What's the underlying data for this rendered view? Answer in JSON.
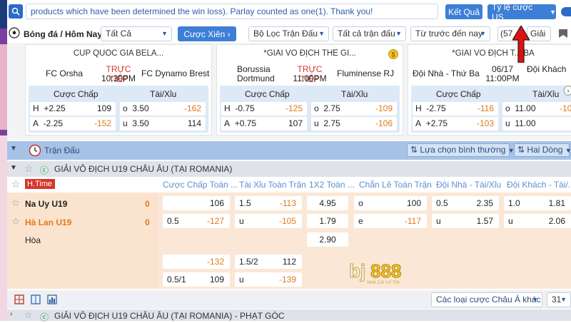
{
  "topbar": {
    "ticker": "products which have been determined the win loss). Parlay counted as one(1). Thank you!",
    "ket_qua": "Kết Quả",
    "odds_format": "Tỷ lệ cược US"
  },
  "filterbar": {
    "sport_label": "Bóng đá / Hôm Nay",
    "all": "Tất Cả",
    "parlay": "Cược Xiên",
    "match_filter": "Bộ Lọc Trận Đấu",
    "all_matches": "Tất cả trận đấu",
    "sort": "Từ trước đến nay",
    "count": "(57",
    "league": "Giải"
  },
  "cards": [
    {
      "league": "CÚP QUỐC GIA BELA...",
      "home": "FC Orsha",
      "away": "FC Dynamo Brest",
      "status": "TRỰC TIẾP",
      "time": "10:30PM",
      "hdr_handicap": "Cược Chấp",
      "hdr_ou": "Tài/Xỉu",
      "rows": [
        {
          "hl": "H",
          "hv": "+2.25",
          "ho": "109",
          "ol": "o",
          "ov": "3.50",
          "oo": "-162"
        },
        {
          "hl": "A",
          "hv": "-2.25",
          "ho": "-152",
          "ol": "u",
          "ov": "3.50",
          "oo": "114"
        }
      ]
    },
    {
      "league": "*GIẢI VÔ ĐỊCH THẾ GI...",
      "home": "Borussia Dortmund",
      "away": "Fluminense RJ",
      "status": "TRỰC TIẾP",
      "time": "11:00PM",
      "hdr_handicap": "Cược Chấp",
      "hdr_ou": "Tài/Xỉu",
      "rows": [
        {
          "hl": "H",
          "hv": "-0.75",
          "ho": "-125",
          "ol": "o",
          "ov": "2.75",
          "oo": "-109"
        },
        {
          "hl": "A",
          "hv": "+0.75",
          "ho": "107",
          "ol": "u",
          "ov": "2.75",
          "oo": "-106"
        }
      ]
    },
    {
      "league": "*GIẢI VÔ ĐỊCH T... BA",
      "home": "Đội Nhà - Thứ Ba",
      "away": "Đội Khách",
      "status": "06/17",
      "time": "11:00PM",
      "hdr_handicap": "Cược Chấp",
      "hdr_ou": "Tài/Xỉu",
      "rows": [
        {
          "hl": "H",
          "hv": "-2.75",
          "ho": "-116",
          "ol": "o",
          "ov": "11.00",
          "oo": "-106"
        },
        {
          "hl": "A",
          "hv": "+2.75",
          "ho": "-103",
          "ol": "u",
          "ov": "11.00",
          "oo": ""
        }
      ]
    }
  ],
  "section": {
    "title": "Trận Đấu",
    "view_select": "Lựa chọn bình thường",
    "lines_select": "Hai Dòng"
  },
  "league": {
    "name": "GIẢI VÔ ĐỊCH U19 CHÂU ÂU (TẠI ROMANIA)"
  },
  "columns": {
    "htime": "H.Time",
    "handicap": "Cược Chấp Toàn ...",
    "ou": "Tài Xỉu Toàn Trận",
    "x12": "1X2 Toàn ...",
    "oddeven": "Chẵn Lẻ Toàn Trận",
    "home_ou": "Đội Nhà - Tài/Xỉu",
    "away_ou": "Đội Khách - Tài/..."
  },
  "match": {
    "home": "Na Uy U19",
    "home_score": "0",
    "away": "Hà Lan U19",
    "away_score": "0",
    "draw": "Hòa",
    "row1": {
      "h1": "",
      "h1o": "106",
      "ou1": "1.5",
      "ou1o": "-113",
      "x1": "4.95",
      "oe1": "o",
      "oe1o": "100",
      "ho1": "0.5",
      "ho1o": "2.35",
      "ao1": "1.0",
      "ao1o": "1.81"
    },
    "row2": {
      "h2": "0.5",
      "h2o": "-127",
      "ou2": "u",
      "ou2o": "-105",
      "x2": "1.79",
      "oe2": "e",
      "oe2o": "-117",
      "ho2": "u",
      "ho2o": "1.57",
      "ao2": "u",
      "ao2o": "2.06"
    },
    "row3": {
      "x3": "2.90"
    },
    "row4": {
      "h4": "",
      "h4o": "-132",
      "ou4": "1.5/2",
      "ou4o": "112"
    },
    "row5": {
      "h5": "0.5/1",
      "h5o": "109",
      "ou5": "u",
      "ou5o": "-139"
    }
  },
  "bottombar": {
    "other_bets": "Các loại cược Châu Á khác",
    "page": "31"
  },
  "next_league": {
    "name": "GIẢI VÔ ĐỊCH U19 CHÂU ÂU (TẠI ROMANIA) - PHẠT GÓC"
  },
  "logo": {
    "brand": "bj888",
    "tagline": "NHÀ CÁI UY TÍN"
  },
  "colors": {
    "accent": "#3d7fd6",
    "negative": "#e07b1a",
    "live": "#d6362b",
    "match_bg": "#fbe4cf"
  }
}
